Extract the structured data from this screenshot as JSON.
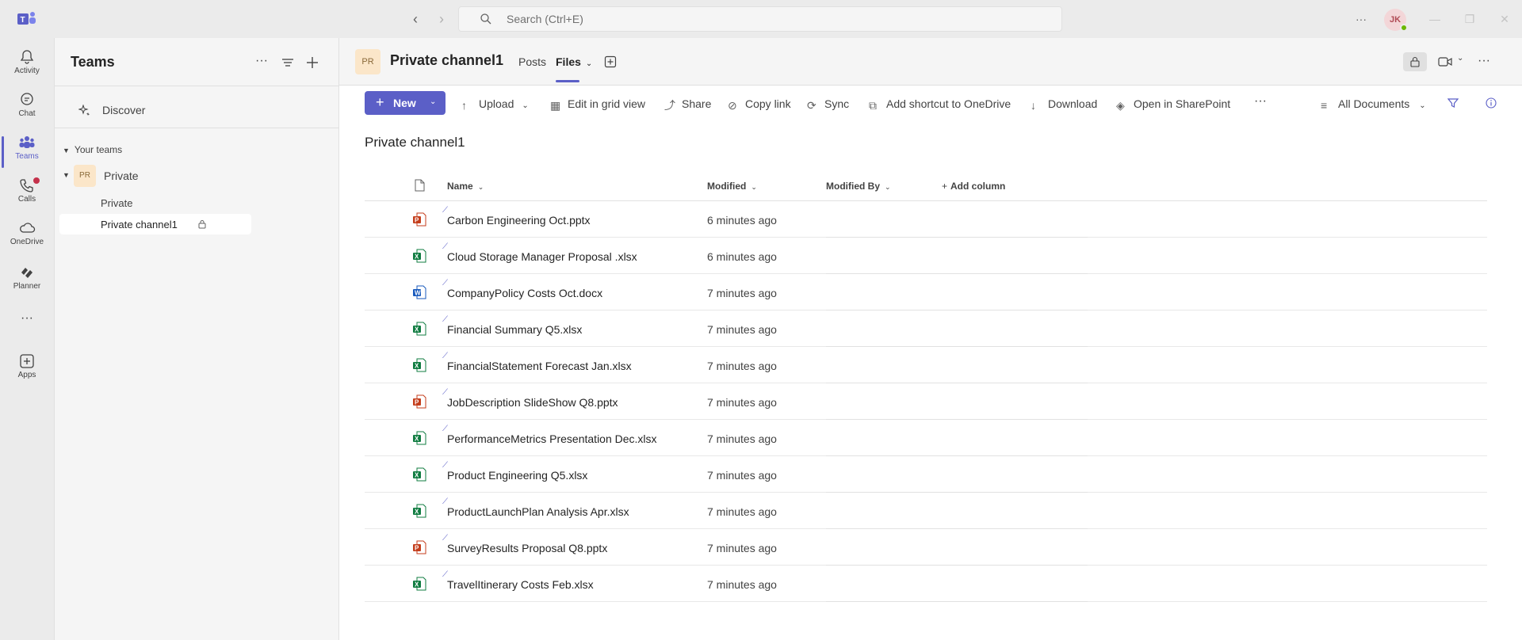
{
  "titlebar": {
    "search_placeholder": "Search (Ctrl+E)",
    "user_initials": "JK"
  },
  "rail": {
    "items": [
      {
        "label": "Activity",
        "icon": "bell-icon"
      },
      {
        "label": "Chat",
        "icon": "chat-icon"
      },
      {
        "label": "Teams",
        "icon": "teams-icon",
        "active": true
      },
      {
        "label": "Calls",
        "icon": "phone-icon",
        "badge": true
      },
      {
        "label": "OneDrive",
        "icon": "cloud-icon"
      },
      {
        "label": "Planner",
        "icon": "planner-icon"
      },
      {
        "label": "Apps",
        "icon": "apps-icon"
      }
    ]
  },
  "sidepanel": {
    "title": "Teams",
    "discover": "Discover",
    "your_teams": "Your teams",
    "team": {
      "initials": "PR",
      "name": "Private"
    },
    "channels": [
      "Private",
      "Private channel1"
    ]
  },
  "channel_header": {
    "initials": "PR",
    "title": "Private channel1",
    "tabs": [
      "Posts",
      "Files"
    ],
    "active_tab": "Files"
  },
  "commandbar": {
    "new": "New",
    "upload": "Upload",
    "edit_grid": "Edit in grid view",
    "share": "Share",
    "copy_link": "Copy link",
    "sync": "Sync",
    "add_shortcut": "Add shortcut to OneDrive",
    "download": "Download",
    "open_sharepoint": "Open in SharePoint",
    "view": "All Documents"
  },
  "library": {
    "title": "Private channel1",
    "columns": {
      "name": "Name",
      "modified": "Modified",
      "modified_by": "Modified By",
      "add_column": "Add column"
    },
    "files": [
      {
        "name": "Carbon Engineering Oct.pptx",
        "type": "pptx",
        "modified": "6 minutes ago"
      },
      {
        "name": "Cloud Storage Manager Proposal .xlsx",
        "type": "xlsx",
        "modified": "6 minutes ago"
      },
      {
        "name": "CompanyPolicy Costs Oct.docx",
        "type": "docx",
        "modified": "7 minutes ago"
      },
      {
        "name": "Financial Summary Q5.xlsx",
        "type": "xlsx",
        "modified": "7 minutes ago"
      },
      {
        "name": "FinancialStatement Forecast Jan.xlsx",
        "type": "xlsx",
        "modified": "7 minutes ago"
      },
      {
        "name": "JobDescription SlideShow Q8.pptx",
        "type": "pptx",
        "modified": "7 minutes ago"
      },
      {
        "name": "PerformanceMetrics Presentation Dec.xlsx",
        "type": "xlsx",
        "modified": "7 minutes ago"
      },
      {
        "name": "Product Engineering Q5.xlsx",
        "type": "xlsx",
        "modified": "7 minutes ago"
      },
      {
        "name": "ProductLaunchPlan Analysis Apr.xlsx",
        "type": "xlsx",
        "modified": "7 minutes ago"
      },
      {
        "name": "SurveyResults Proposal Q8.pptx",
        "type": "pptx",
        "modified": "7 minutes ago"
      },
      {
        "name": "TravelItinerary Costs Feb.xlsx",
        "type": "xlsx",
        "modified": "7 minutes ago"
      }
    ]
  },
  "colors": {
    "accent": "#5b5fc7",
    "excel": "#107c41",
    "powerpoint": "#c43e1c",
    "word": "#185abd"
  }
}
